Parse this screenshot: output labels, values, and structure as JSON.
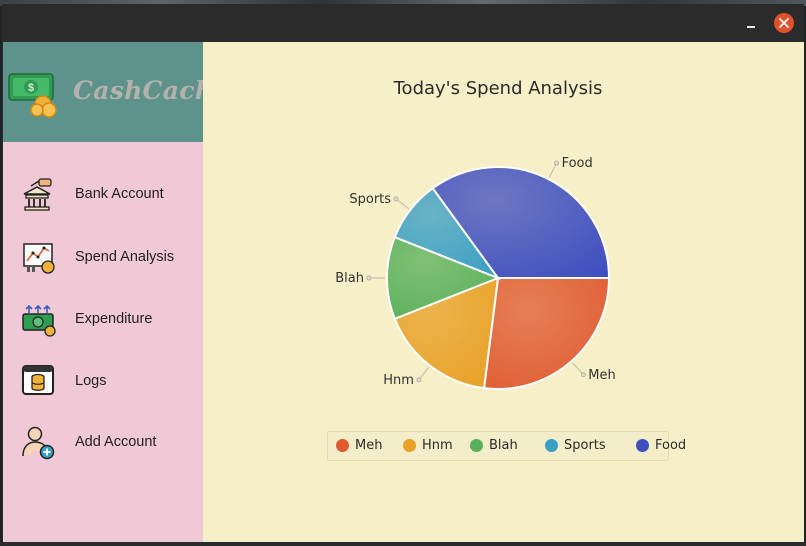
{
  "window": {
    "title": ""
  },
  "brand": {
    "name": "CashCache"
  },
  "sidebar": {
    "items": [
      {
        "label": "Bank Account",
        "icon": "bank-icon"
      },
      {
        "label": "Spend Analysis",
        "icon": "analysis-icon"
      },
      {
        "label": "Expenditure",
        "icon": "money-icon"
      },
      {
        "label": "Logs",
        "icon": "logs-icon"
      },
      {
        "label": "Add Account",
        "icon": "add-user-icon"
      }
    ]
  },
  "chart_data": {
    "type": "pie",
    "title": "Today's Spend Analysis",
    "slices": [
      {
        "label": "Meh",
        "value": 27,
        "color": "#e05a30"
      },
      {
        "label": "Hnm",
        "value": 17,
        "color": "#e8a025"
      },
      {
        "label": "Blah",
        "value": 12,
        "color": "#58b05a"
      },
      {
        "label": "Sports",
        "value": 9,
        "color": "#3a9fc5"
      },
      {
        "label": "Food",
        "value": 35,
        "color": "#3f4fc0"
      }
    ],
    "legend": "bottom",
    "start_angle_deg": 0,
    "direction": "clockwise"
  }
}
